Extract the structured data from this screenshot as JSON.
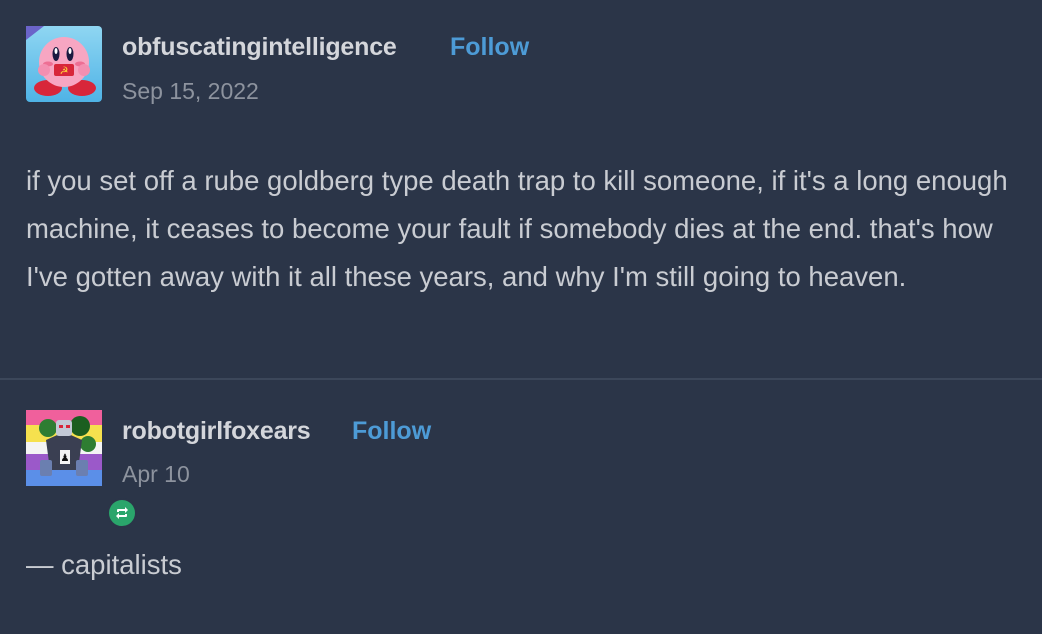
{
  "posts": [
    {
      "username": "obfuscatingintelligence",
      "follow_label": "Follow",
      "date": "Sep 15, 2022",
      "text": "if you set off a rube goldberg type death trap to kill someone, if it's a long enough machine, it ceases to become your fault if somebody dies at the end. that's how I've gotten away with it all these years, and why I'm still going to heaven."
    },
    {
      "username": "robotgirlfoxears",
      "follow_label": "Follow",
      "date": "Apr 10",
      "text": "— capitalists"
    }
  ],
  "colors": {
    "background": "#2b3548",
    "follow": "#4d9bd6",
    "reblog_badge": "#2aa56b"
  }
}
